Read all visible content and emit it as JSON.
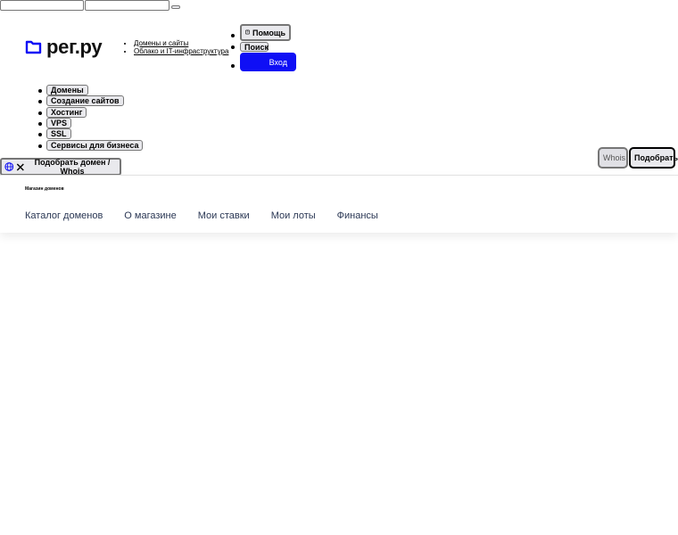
{
  "header": {
    "logo_text": "рег.ру",
    "top_links": [
      "Домены и сайты",
      "Облако и IT-инфраструктура"
    ],
    "help_label": "Помощь",
    "search_label": "Поиск",
    "login_label": "Вход"
  },
  "menu": {
    "items": [
      "Домены",
      "Создание сайтов",
      "Хостинг",
      "VPS",
      "SSL",
      "Сервисы для бизнеса"
    ]
  },
  "domain_search": {
    "label": "Подобрать домен / Whois",
    "whois_label": "Whois",
    "pick_label": "Подобрать"
  },
  "store": {
    "title": "Магазин доменов",
    "nav": [
      "Каталог доменов",
      "О магазине",
      "Мои ставки",
      "Мои лоты",
      "Финансы"
    ]
  },
  "colors": {
    "accent": "#0f0ff5",
    "nav_text": "#2a3754"
  }
}
